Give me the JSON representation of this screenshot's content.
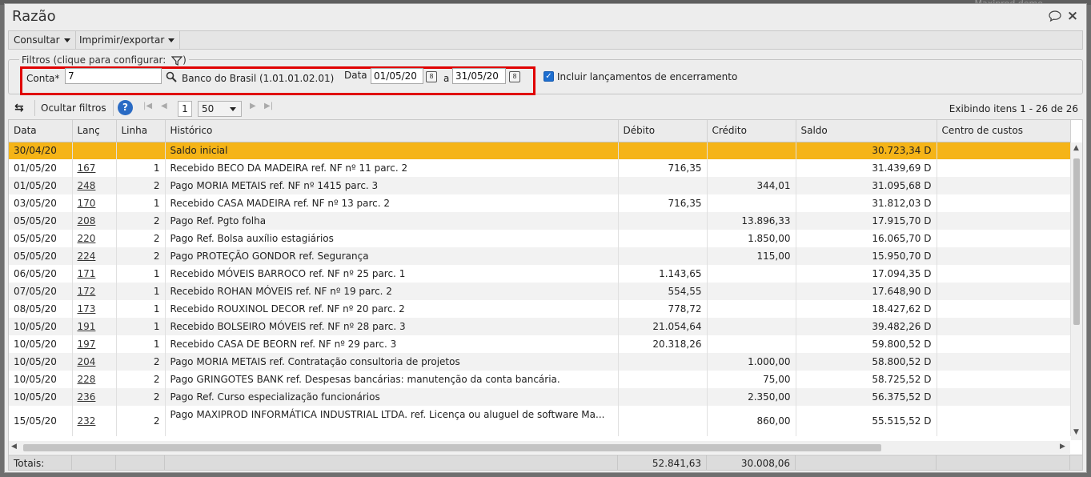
{
  "background_text": "Maxiprod demo",
  "window": {
    "title": "Razão"
  },
  "menu": {
    "consultar": "Consultar",
    "imprimir": "Imprimir/exportar"
  },
  "filters": {
    "legend": "Filtros (clique para configurar:",
    "conta_label": "Conta*",
    "conta_value": "7",
    "conta_desc": "Banco do Brasil (1.01.01.02.01)",
    "data_label": "Data",
    "data_from": "01/05/20",
    "a_label": "a",
    "data_to": "31/05/20",
    "incluir_label": "Incluir lançamentos de encerramento",
    "incluir_checked": true
  },
  "toolbar": {
    "ocultar_label": "Ocultar filtros",
    "page": "1",
    "page_size": "50",
    "pager_info": "Exibindo itens 1 - 26 de 26"
  },
  "columns": [
    "Data",
    "Lanç",
    "Linha",
    "Histórico",
    "Débito",
    "Crédito",
    "Saldo",
    "Centro de custos"
  ],
  "rows": [
    {
      "data": "30/04/20",
      "lanc": "",
      "linha": "",
      "historico": "Saldo inicial",
      "debito": "",
      "credito": "",
      "saldo": "30.723,34 D",
      "centro": ""
    },
    {
      "data": "01/05/20",
      "lanc": "167",
      "linha": "1",
      "historico": "Recebido BECO DA MADEIRA ref. NF nº 11 parc. 2",
      "debito": "716,35",
      "credito": "",
      "saldo": "31.439,69 D",
      "centro": ""
    },
    {
      "data": "01/05/20",
      "lanc": "248",
      "linha": "2",
      "historico": "Pago MORIA METAIS ref. NF nº 1415 parc. 3",
      "debito": "",
      "credito": "344,01",
      "saldo": "31.095,68 D",
      "centro": ""
    },
    {
      "data": "03/05/20",
      "lanc": "170",
      "linha": "1",
      "historico": "Recebido CASA MADEIRA ref. NF nº 13 parc. 2",
      "debito": "716,35",
      "credito": "",
      "saldo": "31.812,03 D",
      "centro": ""
    },
    {
      "data": "05/05/20",
      "lanc": "208",
      "linha": "2",
      "historico": "Pago Ref. Pgto folha",
      "debito": "",
      "credito": "13.896,33",
      "saldo": "17.915,70 D",
      "centro": ""
    },
    {
      "data": "05/05/20",
      "lanc": "220",
      "linha": "2",
      "historico": "Pago Ref. Bolsa auxílio estagiários",
      "debito": "",
      "credito": "1.850,00",
      "saldo": "16.065,70 D",
      "centro": ""
    },
    {
      "data": "05/05/20",
      "lanc": "224",
      "linha": "2",
      "historico": "Pago PROTEÇÃO GONDOR ref. Segurança",
      "debito": "",
      "credito": "115,00",
      "saldo": "15.950,70 D",
      "centro": ""
    },
    {
      "data": "06/05/20",
      "lanc": "171",
      "linha": "1",
      "historico": "Recebido MÓVEIS BARROCO ref. NF nº 25 parc. 1",
      "debito": "1.143,65",
      "credito": "",
      "saldo": "17.094,35 D",
      "centro": ""
    },
    {
      "data": "07/05/20",
      "lanc": "172",
      "linha": "1",
      "historico": "Recebido ROHAN MÓVEIS ref. NF nº 19 parc. 2",
      "debito": "554,55",
      "credito": "",
      "saldo": "17.648,90 D",
      "centro": ""
    },
    {
      "data": "08/05/20",
      "lanc": "173",
      "linha": "1",
      "historico": "Recebido ROUXINOL DECOR ref. NF nº 20 parc. 2",
      "debito": "778,72",
      "credito": "",
      "saldo": "18.427,62 D",
      "centro": ""
    },
    {
      "data": "10/05/20",
      "lanc": "191",
      "linha": "1",
      "historico": "Recebido BOLSEIRO MÓVEIS ref. NF nº 28 parc. 3",
      "debito": "21.054,64",
      "credito": "",
      "saldo": "39.482,26 D",
      "centro": ""
    },
    {
      "data": "10/05/20",
      "lanc": "197",
      "linha": "1",
      "historico": "Recebido CASA DE BEORN ref. NF nº 29 parc. 3",
      "debito": "20.318,26",
      "credito": "",
      "saldo": "59.800,52 D",
      "centro": ""
    },
    {
      "data": "10/05/20",
      "lanc": "204",
      "linha": "2",
      "historico": "Pago MORIA METAIS ref. Contratação consultoria de projetos",
      "debito": "",
      "credito": "1.000,00",
      "saldo": "58.800,52 D",
      "centro": ""
    },
    {
      "data": "10/05/20",
      "lanc": "228",
      "linha": "2",
      "historico": "Pago GRINGOTES BANK ref. Despesas bancárias: manutenção da conta bancária.",
      "debito": "",
      "credito": "75,00",
      "saldo": "58.725,52 D",
      "centro": ""
    },
    {
      "data": "10/05/20",
      "lanc": "236",
      "linha": "2",
      "historico": "Pago Ref. Curso especialização funcionários",
      "debito": "",
      "credito": "2.350,00",
      "saldo": "56.375,52 D",
      "centro": ""
    },
    {
      "data": "15/05/20",
      "lanc": "232",
      "linha": "2",
      "historico": "Pago MAXIPROD INFORMÁTICA INDUSTRIAL LTDA. ref. Licença ou aluguel de software Ma...",
      "debito": "",
      "credito": "860,00",
      "saldo": "55.515,52 D",
      "centro": ""
    }
  ],
  "totals": {
    "label": "Totais:",
    "debito": "52.841,63",
    "credito": "30.008,06"
  }
}
